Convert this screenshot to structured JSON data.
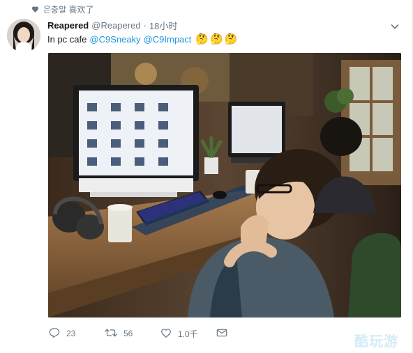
{
  "social_context": {
    "icon": "heart-icon",
    "text": "은충알 喜欢了"
  },
  "tweet": {
    "author": {
      "fullname": "Reapered",
      "username": "@Reapered",
      "avatar": "avatar-photo"
    },
    "separator": "·",
    "timestamp": "18小时",
    "text": "In pc cafe",
    "mentions": [
      "@C9Sneaky",
      "@C9Impact"
    ],
    "emojis": [
      "🤔",
      "🤔",
      "🤔"
    ],
    "media": {
      "kind": "photo"
    },
    "actions": {
      "reply": {
        "icon": "reply-icon",
        "count": "23"
      },
      "retweet": {
        "icon": "retweet-icon",
        "count": "56"
      },
      "like": {
        "icon": "heart-outline-icon",
        "count": "1.0千"
      },
      "dm": {
        "icon": "envelope-icon"
      }
    },
    "menu": {
      "icon": "chevron-down-icon"
    }
  },
  "watermark": {
    "text": "酷玩游"
  },
  "colors": {
    "link": "#1b95e0",
    "secondary_text": "#657786",
    "primary_text": "#14171a"
  }
}
